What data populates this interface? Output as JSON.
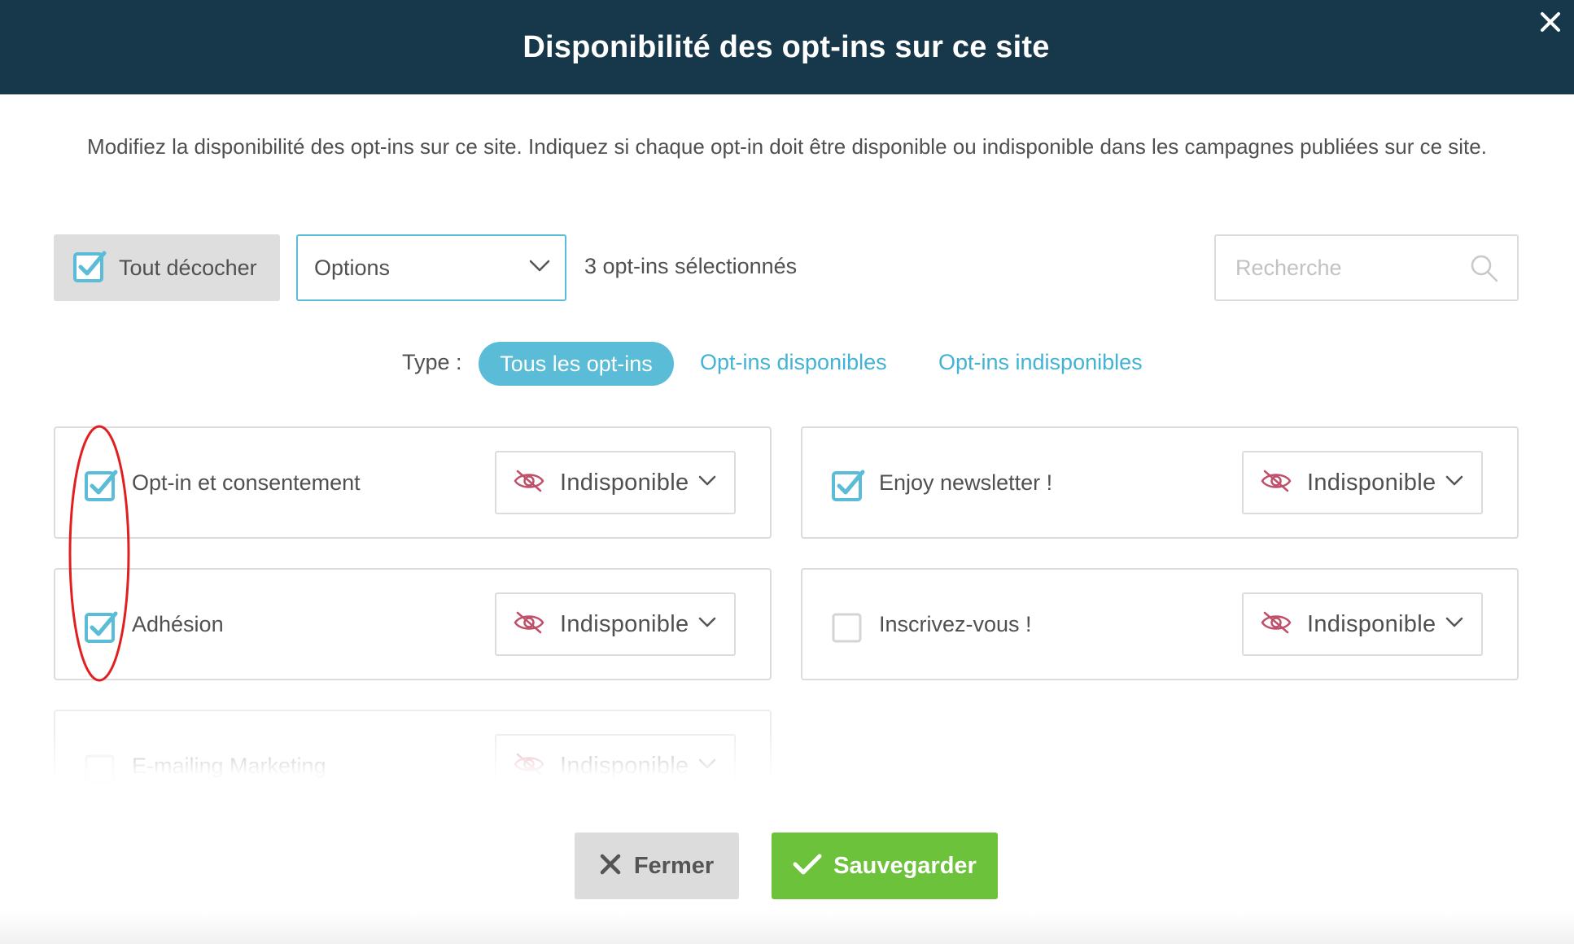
{
  "header": {
    "title": "Disponibilité des opt-ins sur ce site"
  },
  "intro": {
    "text": "Modifiez la disponibilité des opt-ins sur ce site. Indiquez si chaque opt-in doit être disponible ou indisponible dans les campagnes publiées sur ce site."
  },
  "toolbar": {
    "uncheck_all_label": "Tout décocher",
    "options_label": "Options",
    "selected_count": "3 opt-ins sélectionnés",
    "search_placeholder": "Recherche"
  },
  "filter": {
    "type_label": "Type :",
    "tabs": [
      {
        "label": "Tous les opt-ins",
        "active": true
      },
      {
        "label": "Opt-ins disponibles",
        "active": false
      },
      {
        "label": "Opt-ins indisponibles",
        "active": false
      }
    ]
  },
  "optins": [
    {
      "name": "Opt-in et consentement",
      "checked": true,
      "status": "Indisponible"
    },
    {
      "name": "Enjoy newsletter !",
      "checked": true,
      "status": "Indisponible"
    },
    {
      "name": "Adhésion",
      "checked": true,
      "status": "Indisponible"
    },
    {
      "name": "Inscrivez-vous !",
      "checked": false,
      "status": "Indisponible"
    },
    {
      "name": "E-mailing Marketing",
      "checked": false,
      "status": "Indisponible"
    }
  ],
  "footer": {
    "close_label": "Fermer",
    "save_label": "Sauvegarder"
  },
  "colors": {
    "header_bg": "#17374b",
    "accent": "#5bbcd8",
    "link": "#43b3d5",
    "save_green": "#6cc23a",
    "unavailable_icon": "#c0506a",
    "annotation_red": "#e02020"
  },
  "icons": {
    "close": "close-icon",
    "checkbox_checked": "checkbox-checked-icon",
    "checkbox_unchecked": "checkbox-unchecked-icon",
    "chevron": "chevron-down-icon",
    "search": "search-icon",
    "unavailable": "eye-slash-icon",
    "save": "checkmark-icon"
  }
}
